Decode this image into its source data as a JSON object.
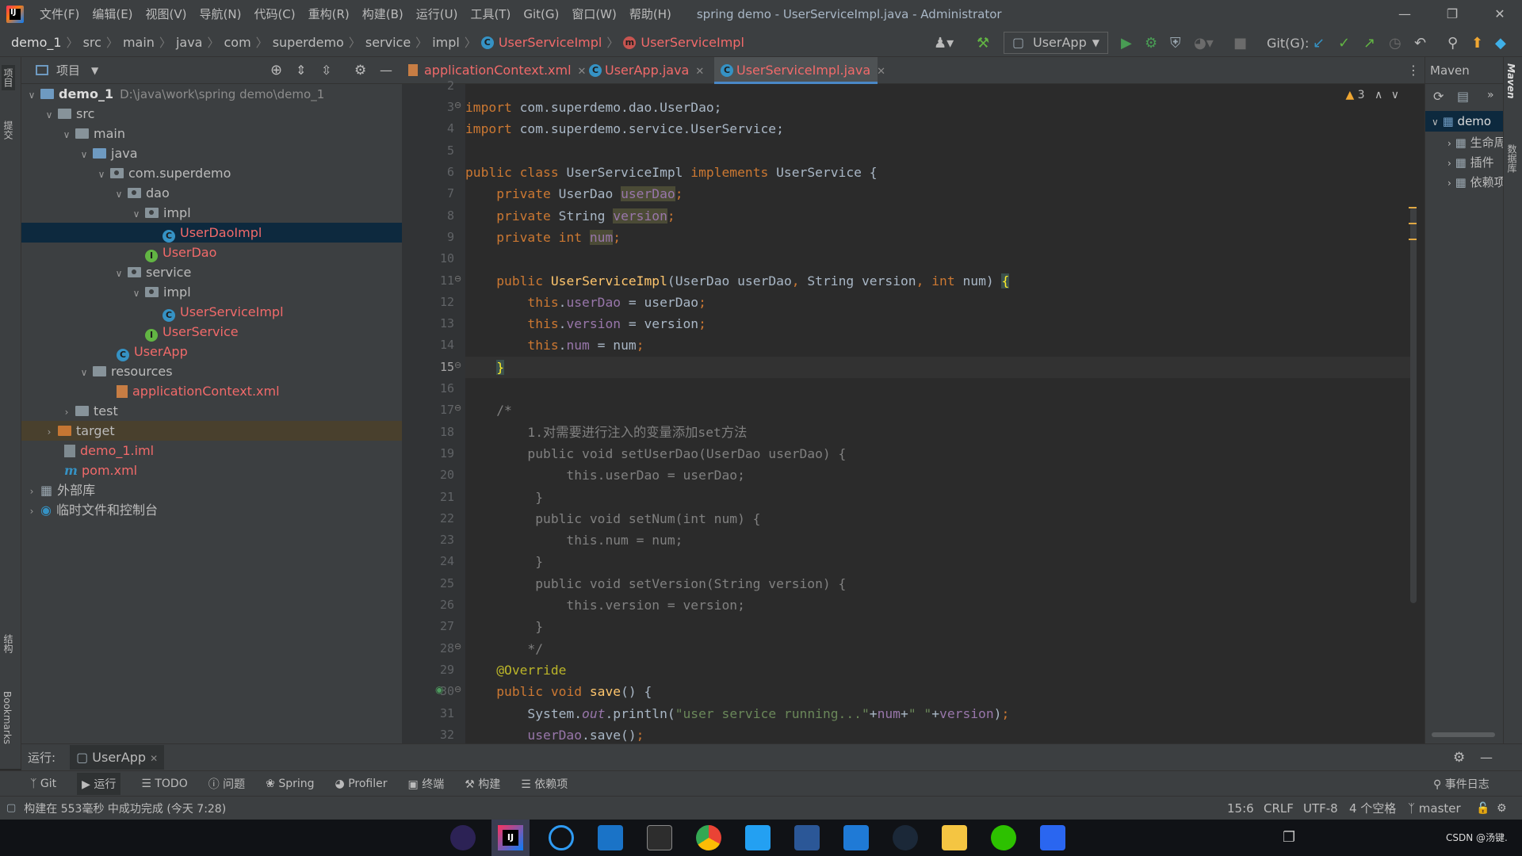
{
  "titlebar": {
    "menu": [
      "文件(F)",
      "编辑(E)",
      "视图(V)",
      "导航(N)",
      "代码(C)",
      "重构(R)",
      "构建(B)",
      "运行(U)",
      "工具(T)",
      "Git(G)",
      "窗口(W)",
      "帮助(H)"
    ],
    "window_title": "spring demo - UserServiceImpl.java - Administrator"
  },
  "navbar": {
    "crumbs": [
      "demo_1",
      "src",
      "main",
      "java",
      "com",
      "superdemo",
      "service",
      "impl"
    ],
    "class1": "UserServiceImpl",
    "class2": "UserServiceImpl",
    "run_config": "UserApp",
    "git_label": "Git(G):"
  },
  "left_strip": {
    "project": "项目",
    "commit": "提交",
    "structure": "结构",
    "bookmarks": "Bookmarks"
  },
  "project_panel": {
    "title": "项目",
    "tree": {
      "root": "demo_1",
      "root_path": "D:\\java\\work\\spring demo\\demo_1",
      "src": "src",
      "main": "main",
      "java": "java",
      "pkg": "com.superdemo",
      "dao": "dao",
      "dao_impl": "impl",
      "userdaoimpl": "UserDaoImpl",
      "userdao": "UserDao",
      "service": "service",
      "service_impl": "impl",
      "userserviceimpl": "UserServiceImpl",
      "userservice": "UserService",
      "userapp": "UserApp",
      "resources": "resources",
      "appctx": "applicationContext.xml",
      "test": "test",
      "target": "target",
      "iml": "demo_1.iml",
      "pom": "pom.xml",
      "extlib": "外部库",
      "scratch": "临时文件和控制台"
    }
  },
  "tabs": [
    "applicationContext.xml",
    "UserApp.java",
    "UserServiceImpl.java"
  ],
  "editor": {
    "warning_count": "3",
    "line_numbers": [
      "2",
      "3",
      "4",
      "5",
      "6",
      "7",
      "8",
      "9",
      "10",
      "11",
      "12",
      "13",
      "14",
      "15",
      "16",
      "17",
      "18",
      "19",
      "20",
      "21",
      "22",
      "23",
      "24",
      "25",
      "26",
      "27",
      "28",
      "29",
      "30",
      "31",
      "32"
    ],
    "current_line": "15"
  },
  "maven": {
    "title": "Maven",
    "root": "demo",
    "items": [
      "生命周期",
      "插件",
      "依赖项"
    ],
    "side_label": "Maven",
    "db_label": "数据库"
  },
  "run_bar": {
    "label": "运行:",
    "tab": "UserApp"
  },
  "tool_windows": [
    "Git",
    "运行",
    "TODO",
    "问题",
    "Spring",
    "Profiler",
    "终端",
    "构建",
    "依赖项"
  ],
  "tool_window_right": "事件日志",
  "status": {
    "message": "构建在 553毫秒 中成功完成 (今天 7:28)",
    "position": "15:6",
    "line_sep": "CRLF",
    "encoding": "UTF-8",
    "indent": "4 个空格",
    "branch": "master"
  },
  "taskbar": {
    "tray_text": "CSDN @汤键."
  },
  "colors": {
    "accent": "#4a88c7",
    "selected_row": "#0d293e",
    "keyword": "#cc7832",
    "field": "#9876aa",
    "string": "#6a8759"
  }
}
